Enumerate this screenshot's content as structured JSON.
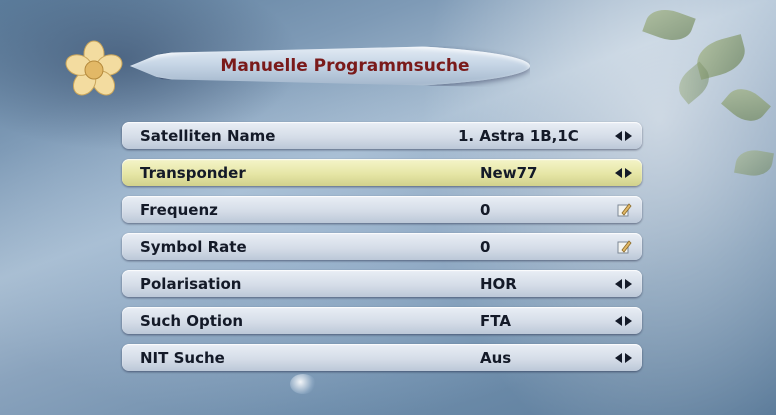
{
  "menu": {
    "title": "Manuelle Programmsuche",
    "rows": [
      {
        "label": "Satelliten Name",
        "value": "1. Astra 1B,1C",
        "control": "arrows"
      },
      {
        "label": "Transponder",
        "value": "New77",
        "control": "arrows",
        "selected": true
      },
      {
        "label": "Frequenz",
        "value": "0",
        "control": "edit"
      },
      {
        "label": "Symbol Rate",
        "value": "0",
        "control": "edit"
      },
      {
        "label": "Polarisation",
        "value": "HOR",
        "control": "arrows"
      },
      {
        "label": "Such Option",
        "value": "FTA",
        "control": "arrows"
      },
      {
        "label": "NIT Suche",
        "value": "Aus",
        "control": "arrows"
      }
    ]
  },
  "colors": {
    "title_text": "#7a1a1a",
    "row_text": "#141a28",
    "row_bg": "#d5dde8",
    "row_selected_bg": "#e6e6a6"
  },
  "icons": {
    "logo": "flower-icon",
    "left": "arrow-left-icon",
    "right": "arrow-right-icon",
    "edit": "edit-icon"
  }
}
